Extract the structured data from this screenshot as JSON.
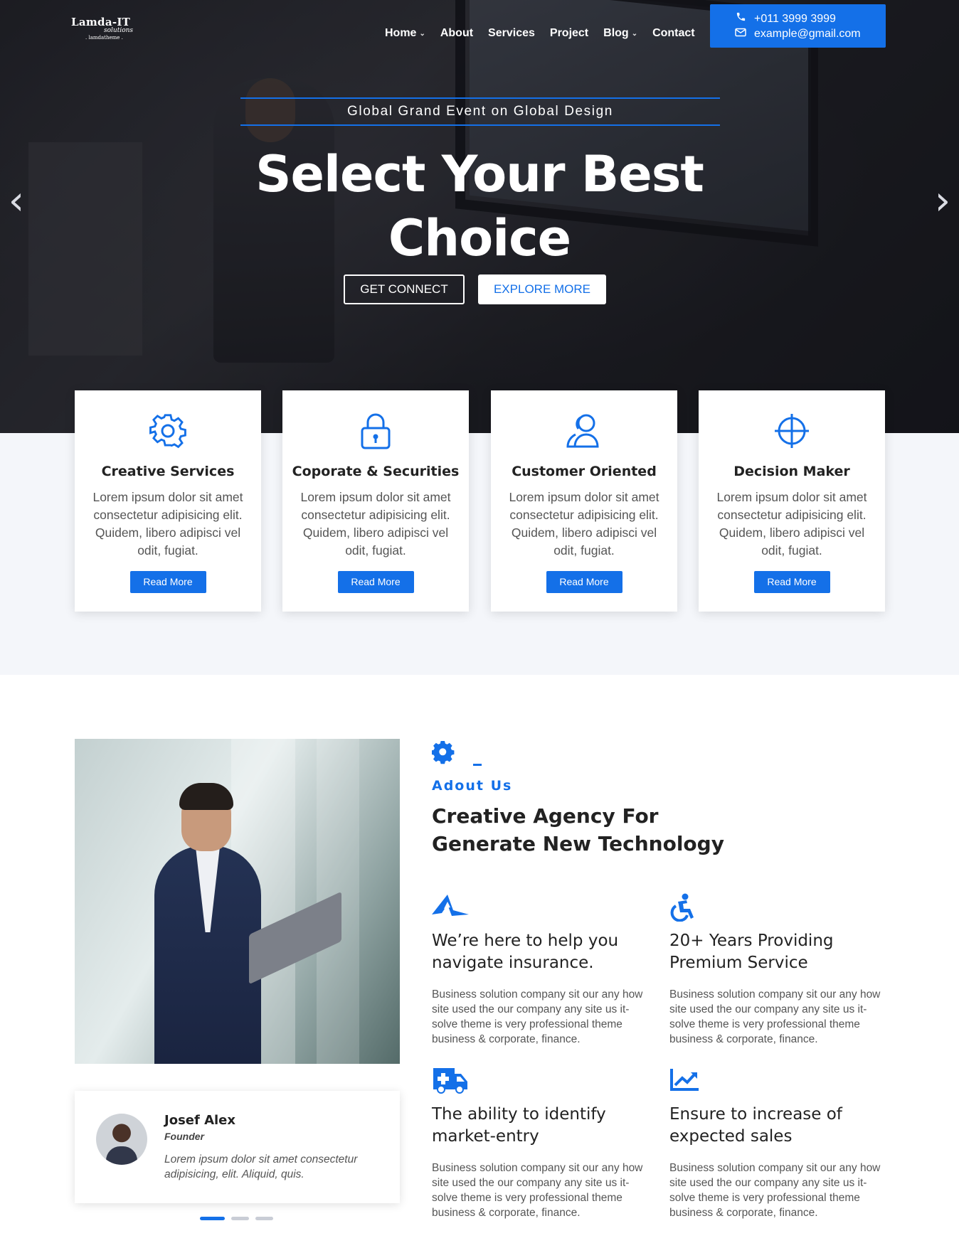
{
  "brand": {
    "logo_line1": "Lamda-IT",
    "logo_line2": "solutions",
    "logo_line3": ". lamdatheme ."
  },
  "nav": {
    "items": [
      {
        "label": "Home",
        "has_dropdown": true
      },
      {
        "label": "About",
        "has_dropdown": false
      },
      {
        "label": "Services",
        "has_dropdown": false
      },
      {
        "label": "Project",
        "has_dropdown": false
      },
      {
        "label": "Blog",
        "has_dropdown": true
      },
      {
        "label": "Contact",
        "has_dropdown": false
      }
    ],
    "chevron": "⌄"
  },
  "contact": {
    "phone": "+011 3999 3999",
    "email": "example@gmail.com",
    "phone_icon": "phone-icon",
    "email_icon": "envelope-icon"
  },
  "hero": {
    "tagline": "Global Grand Event on Global Design",
    "title_line1": "Select Your Best",
    "title_line2": "Choice",
    "primary_btn": "GET CONNECT",
    "secondary_btn": "EXPLORE MORE",
    "prev_arrow": "‹",
    "next_arrow": "›"
  },
  "features": [
    {
      "icon": "gear-icon",
      "title": "Creative Services",
      "desc": "Lorem ipsum dolor sit amet consectetur adipisicing elit. Quidem, libero adipisci vel odit, fugiat.",
      "button": "Read More"
    },
    {
      "icon": "lock-icon",
      "title": "Coporate & Securities",
      "desc": "Lorem ipsum dolor sit amet consectetur adipisicing elit. Quidem, libero adipisci vel odit, fugiat.",
      "button": "Read More"
    },
    {
      "icon": "users-icon",
      "title": "Customer Oriented",
      "desc": "Lorem ipsum dolor sit amet consectetur adipisicing elit. Quidem, libero adipisci vel odit, fugiat.",
      "button": "Read More"
    },
    {
      "icon": "crosshair-icon",
      "title": "Decision Maker",
      "desc": "Lorem ipsum dolor sit amet consectetur adipisicing elit. Quidem, libero adipisci vel odit, fugiat.",
      "button": "Read More"
    }
  ],
  "about": {
    "subtitle": "Adout Us",
    "title": "Creative Agency For Generate New Technology",
    "items": [
      {
        "icon": "paper-plane-icon",
        "title": "We’re here to help you navigate insurance.",
        "desc": "Business solution company sit our any how site used the our company any site us it-solve theme is very professional theme business & corporate, finance."
      },
      {
        "icon": "accessibility-icon",
        "title": "20+ Years Providing Premium Service",
        "desc": "Business solution company sit our any how site used the our company any site us it-solve theme is very professional theme business & corporate, finance."
      },
      {
        "icon": "ambulance-icon",
        "title": "The ability to identify market-entry",
        "desc": "Business solution company sit our any how site used the our company any site us it-solve theme is very professional theme business & corporate, finance."
      },
      {
        "icon": "chart-line-icon",
        "title": "Ensure to increase of expected sales",
        "desc": "Business solution company sit our any how site used the our company any site us it-solve theme is very professional theme business & corporate, finance."
      }
    ]
  },
  "testimonial": {
    "name": "Josef Alex",
    "role": "Founder",
    "quote": "Lorem ipsum dolor sit amet consectetur adipisicing, elit. Aliquid, quis."
  },
  "colors": {
    "accent": "#1470e8",
    "light_bg": "#f4f6fa"
  }
}
